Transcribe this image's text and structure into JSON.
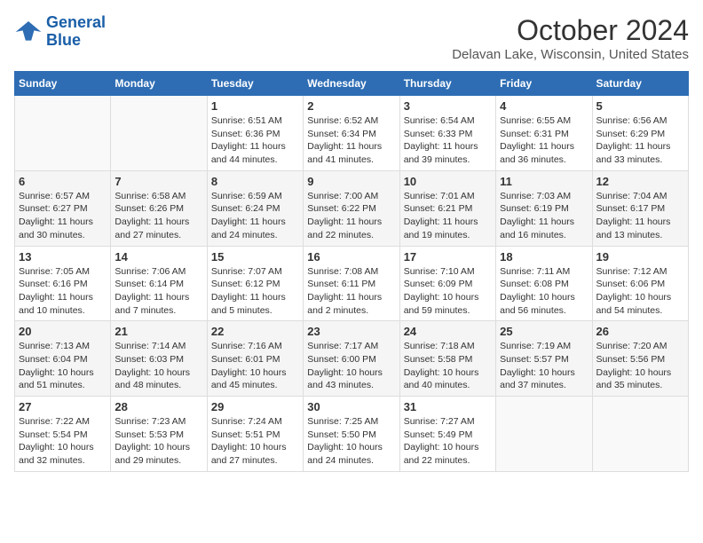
{
  "logo": {
    "line1": "General",
    "line2": "Blue"
  },
  "title": "October 2024",
  "subtitle": "Delavan Lake, Wisconsin, United States",
  "headers": [
    "Sunday",
    "Monday",
    "Tuesday",
    "Wednesday",
    "Thursday",
    "Friday",
    "Saturday"
  ],
  "weeks": [
    [
      {
        "day": "",
        "info": ""
      },
      {
        "day": "",
        "info": ""
      },
      {
        "day": "1",
        "info": "Sunrise: 6:51 AM\nSunset: 6:36 PM\nDaylight: 11 hours and 44 minutes."
      },
      {
        "day": "2",
        "info": "Sunrise: 6:52 AM\nSunset: 6:34 PM\nDaylight: 11 hours and 41 minutes."
      },
      {
        "day": "3",
        "info": "Sunrise: 6:54 AM\nSunset: 6:33 PM\nDaylight: 11 hours and 39 minutes."
      },
      {
        "day": "4",
        "info": "Sunrise: 6:55 AM\nSunset: 6:31 PM\nDaylight: 11 hours and 36 minutes."
      },
      {
        "day": "5",
        "info": "Sunrise: 6:56 AM\nSunset: 6:29 PM\nDaylight: 11 hours and 33 minutes."
      }
    ],
    [
      {
        "day": "6",
        "info": "Sunrise: 6:57 AM\nSunset: 6:27 PM\nDaylight: 11 hours and 30 minutes."
      },
      {
        "day": "7",
        "info": "Sunrise: 6:58 AM\nSunset: 6:26 PM\nDaylight: 11 hours and 27 minutes."
      },
      {
        "day": "8",
        "info": "Sunrise: 6:59 AM\nSunset: 6:24 PM\nDaylight: 11 hours and 24 minutes."
      },
      {
        "day": "9",
        "info": "Sunrise: 7:00 AM\nSunset: 6:22 PM\nDaylight: 11 hours and 22 minutes."
      },
      {
        "day": "10",
        "info": "Sunrise: 7:01 AM\nSunset: 6:21 PM\nDaylight: 11 hours and 19 minutes."
      },
      {
        "day": "11",
        "info": "Sunrise: 7:03 AM\nSunset: 6:19 PM\nDaylight: 11 hours and 16 minutes."
      },
      {
        "day": "12",
        "info": "Sunrise: 7:04 AM\nSunset: 6:17 PM\nDaylight: 11 hours and 13 minutes."
      }
    ],
    [
      {
        "day": "13",
        "info": "Sunrise: 7:05 AM\nSunset: 6:16 PM\nDaylight: 11 hours and 10 minutes."
      },
      {
        "day": "14",
        "info": "Sunrise: 7:06 AM\nSunset: 6:14 PM\nDaylight: 11 hours and 7 minutes."
      },
      {
        "day": "15",
        "info": "Sunrise: 7:07 AM\nSunset: 6:12 PM\nDaylight: 11 hours and 5 minutes."
      },
      {
        "day": "16",
        "info": "Sunrise: 7:08 AM\nSunset: 6:11 PM\nDaylight: 11 hours and 2 minutes."
      },
      {
        "day": "17",
        "info": "Sunrise: 7:10 AM\nSunset: 6:09 PM\nDaylight: 10 hours and 59 minutes."
      },
      {
        "day": "18",
        "info": "Sunrise: 7:11 AM\nSunset: 6:08 PM\nDaylight: 10 hours and 56 minutes."
      },
      {
        "day": "19",
        "info": "Sunrise: 7:12 AM\nSunset: 6:06 PM\nDaylight: 10 hours and 54 minutes."
      }
    ],
    [
      {
        "day": "20",
        "info": "Sunrise: 7:13 AM\nSunset: 6:04 PM\nDaylight: 10 hours and 51 minutes."
      },
      {
        "day": "21",
        "info": "Sunrise: 7:14 AM\nSunset: 6:03 PM\nDaylight: 10 hours and 48 minutes."
      },
      {
        "day": "22",
        "info": "Sunrise: 7:16 AM\nSunset: 6:01 PM\nDaylight: 10 hours and 45 minutes."
      },
      {
        "day": "23",
        "info": "Sunrise: 7:17 AM\nSunset: 6:00 PM\nDaylight: 10 hours and 43 minutes."
      },
      {
        "day": "24",
        "info": "Sunrise: 7:18 AM\nSunset: 5:58 PM\nDaylight: 10 hours and 40 minutes."
      },
      {
        "day": "25",
        "info": "Sunrise: 7:19 AM\nSunset: 5:57 PM\nDaylight: 10 hours and 37 minutes."
      },
      {
        "day": "26",
        "info": "Sunrise: 7:20 AM\nSunset: 5:56 PM\nDaylight: 10 hours and 35 minutes."
      }
    ],
    [
      {
        "day": "27",
        "info": "Sunrise: 7:22 AM\nSunset: 5:54 PM\nDaylight: 10 hours and 32 minutes."
      },
      {
        "day": "28",
        "info": "Sunrise: 7:23 AM\nSunset: 5:53 PM\nDaylight: 10 hours and 29 minutes."
      },
      {
        "day": "29",
        "info": "Sunrise: 7:24 AM\nSunset: 5:51 PM\nDaylight: 10 hours and 27 minutes."
      },
      {
        "day": "30",
        "info": "Sunrise: 7:25 AM\nSunset: 5:50 PM\nDaylight: 10 hours and 24 minutes."
      },
      {
        "day": "31",
        "info": "Sunrise: 7:27 AM\nSunset: 5:49 PM\nDaylight: 10 hours and 22 minutes."
      },
      {
        "day": "",
        "info": ""
      },
      {
        "day": "",
        "info": ""
      }
    ]
  ]
}
